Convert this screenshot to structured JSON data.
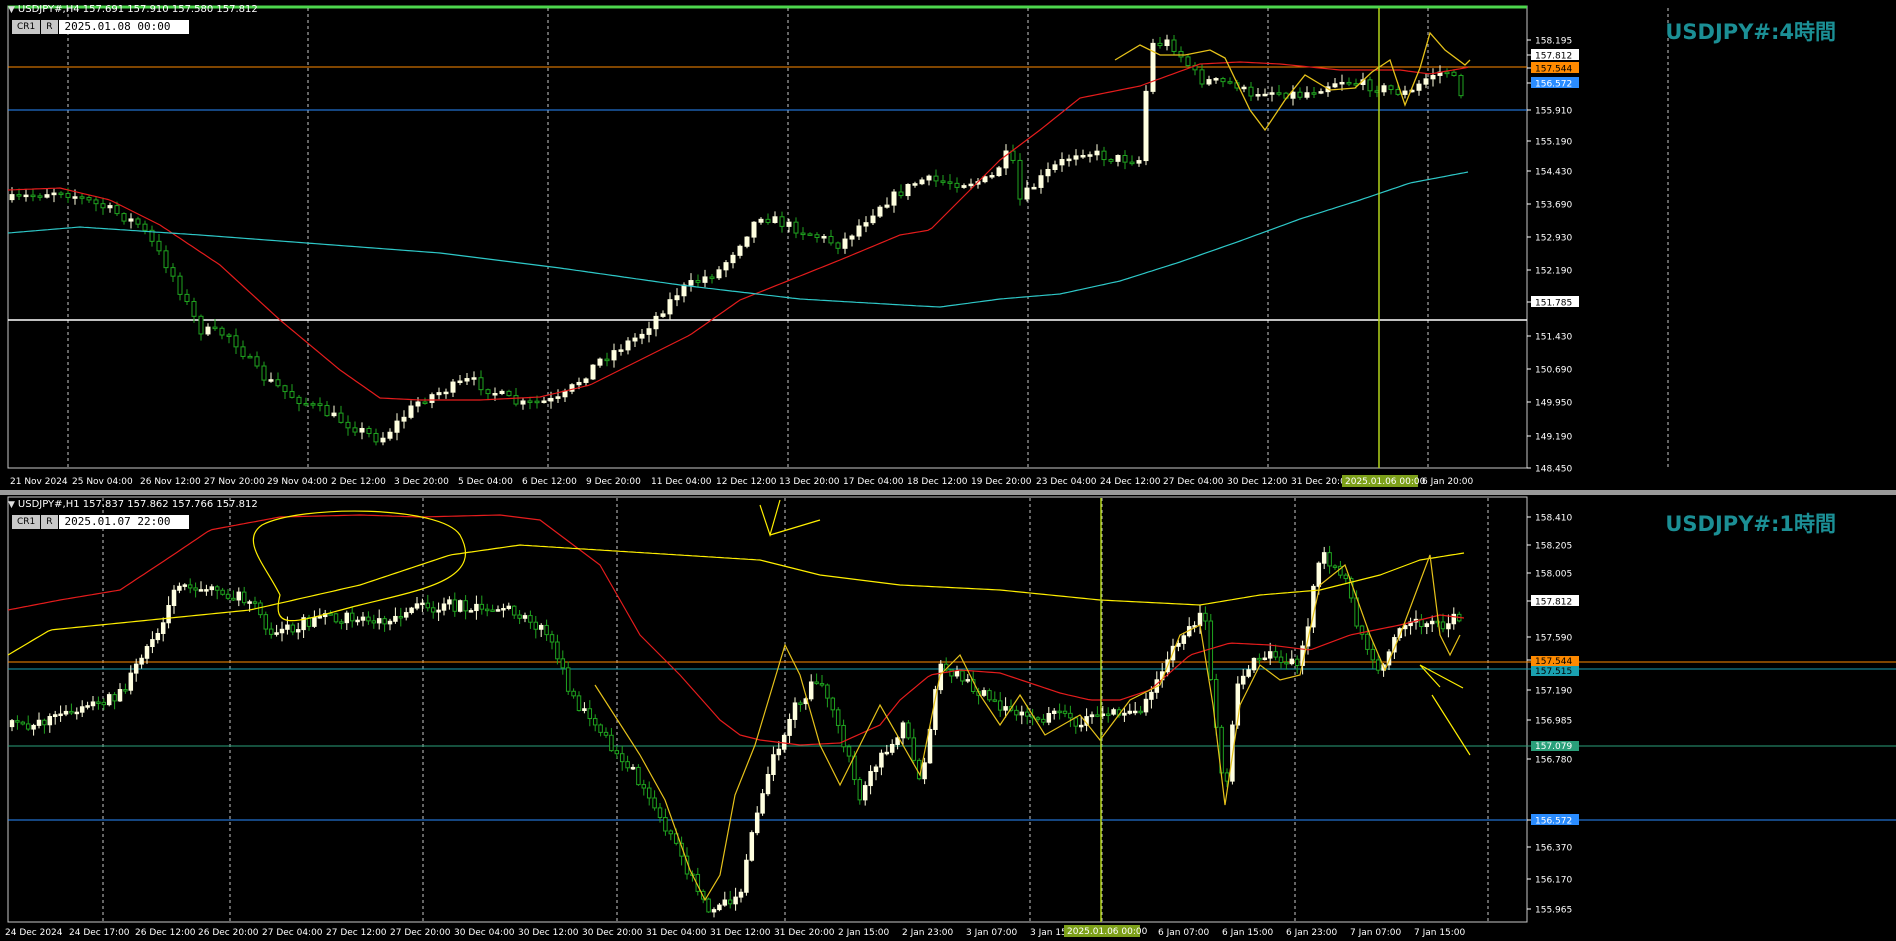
{
  "colors": {
    "background": "#000000",
    "grid": "#c8c8c8",
    "bull": "#ffffe0",
    "bear": "#1fa31f",
    "ma_fast": "#e51c1c",
    "ma_slow": "#2ec8c8",
    "ma_yellow": "#ffef00",
    "hline_orange": "#ff8a00",
    "hline_blue": "#2a8cff",
    "hline_white": "#ffffff",
    "hline_green": "#2aa07a",
    "annotation": "#e6c21a",
    "vline": "#b3d41a",
    "watermark": "#1b8f95"
  },
  "pane1": {
    "header": "USDJPY#,H4  157.691 157.910 157.580 157.812",
    "mini_cr": "CR1",
    "mini_r": "R",
    "crosshair_time": "2025.01.08 00:00",
    "watermark": "USDJPY#:4時間",
    "price_labels": [
      "158.195",
      "157.812",
      "157.544",
      "156.572",
      "155.910",
      "155.190",
      "154.430",
      "153.690",
      "152.930",
      "152.190",
      "151.785",
      "151.430",
      "150.690",
      "149.950",
      "149.190",
      "148.450"
    ],
    "time_labels": [
      "21 Nov 2024",
      "25 Nov 04:00",
      "26 Nov 12:00",
      "27 Nov 20:00",
      "29 Nov 04:00",
      "2 Dec 12:00",
      "3 Dec 20:00",
      "5 Dec 04:00",
      "6 Dec 12:00",
      "9 Dec 20:00",
      "11 Dec 04:00",
      "12 Dec 12:00",
      "13 Dec 20:00",
      "17 Dec 04:00",
      "18 Dec 12:00",
      "19 Dec 20:00",
      "23 Dec 04:00",
      "24 Dec 12:00",
      "27 Dec 04:00",
      "30 Dec 12:00",
      "31 Dec 20:00",
      "6 Jan 20:00"
    ],
    "vline_label": "2025.01.06 00:00",
    "hlines": {
      "orange": "157.544",
      "blue": "156.572",
      "white": "151.785",
      "current": "157.812"
    }
  },
  "pane2": {
    "header": "USDJPY#,H1  157.837 157.862 157.766 157.812",
    "mini_cr": "CR1",
    "mini_r": "R",
    "crosshair_time": "2025.01.07 22:00",
    "watermark": "USDJPY#:1時間",
    "price_labels": [
      "158.410",
      "158.205",
      "158.005",
      "157.812",
      "157.590",
      "157.390",
      "157.190",
      "156.985",
      "156.780",
      "156.572",
      "156.370",
      "156.170",
      "155.965"
    ],
    "orange_label": "157.544",
    "teal_label": "157.515",
    "green_label": "157.079",
    "time_labels": [
      "24 Dec 2024",
      "24 Dec 17:00",
      "26 Dec 12:00",
      "26 Dec 20:00",
      "27 Dec 04:00",
      "27 Dec 12:00",
      "27 Dec 20:00",
      "30 Dec 04:00",
      "30 Dec 12:00",
      "30 Dec 20:00",
      "31 Dec 04:00",
      "31 Dec 12:00",
      "31 Dec 20:00",
      "2 Jan 15:00",
      "2 Jan 23:00",
      "3 Jan 07:00",
      "3 Jan 15",
      "6 Jan 07:00",
      "6 Jan 15:00",
      "6 Jan 23:00",
      "7 Jan 07:00",
      "7 Jan 15:00"
    ],
    "vline_label": "2025.01.06 00:00"
  }
}
